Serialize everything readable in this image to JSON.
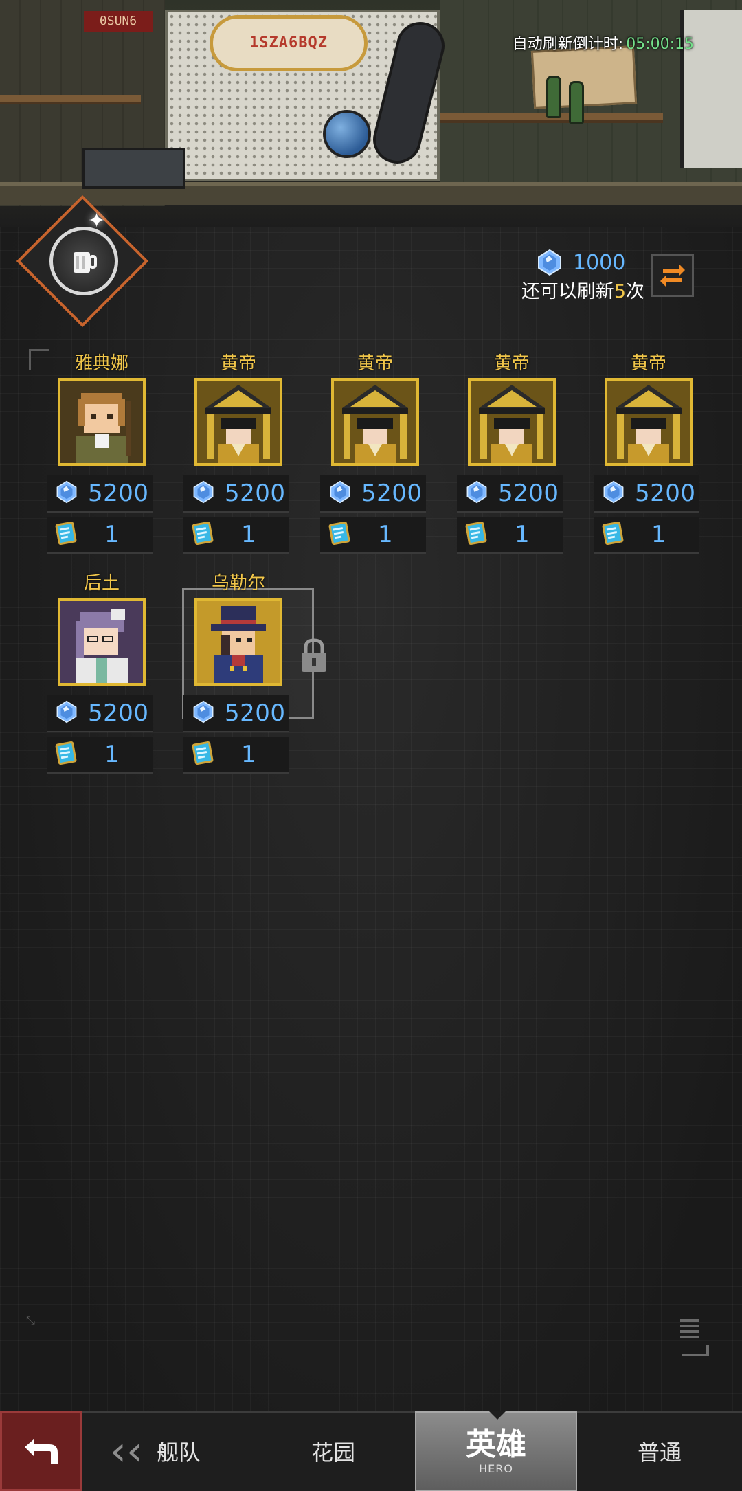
{
  "scene": {
    "sign_text": "1SZA6BQZ",
    "plate_text": "0SUN6",
    "refresh_timer_label": "自动刷新倒计时:",
    "refresh_timer_value": "05:00:15"
  },
  "currency": {
    "gem_icon": "blue-gem-icon",
    "amount": "1000",
    "refresh_prefix": "还可以刷新",
    "refresh_count": "5",
    "refresh_suffix": "次",
    "refresh_button_icon": "refresh-arrows-icon"
  },
  "heroes": [
    {
      "name": "雅典娜",
      "price": "5200",
      "tickets": "1",
      "portrait": "athena",
      "selected": false,
      "locked": false
    },
    {
      "name": "黄帝",
      "price": "5200",
      "tickets": "1",
      "portrait": "huangdi",
      "selected": false,
      "locked": false
    },
    {
      "name": "黄帝",
      "price": "5200",
      "tickets": "1",
      "portrait": "huangdi",
      "selected": false,
      "locked": false
    },
    {
      "name": "黄帝",
      "price": "5200",
      "tickets": "1",
      "portrait": "huangdi",
      "selected": false,
      "locked": false
    },
    {
      "name": "黄帝",
      "price": "5200",
      "tickets": "1",
      "portrait": "huangdi",
      "selected": false,
      "locked": false
    },
    {
      "name": "后土",
      "price": "5200",
      "tickets": "1",
      "portrait": "houtu",
      "selected": false,
      "locked": false
    },
    {
      "name": "乌勒尔",
      "price": "5200",
      "tickets": "1",
      "portrait": "ullr",
      "selected": true,
      "locked": true
    }
  ],
  "nav": {
    "back_icon": "return-arrow-icon",
    "tabs": [
      {
        "label": "舰队"
      },
      {
        "label": "花园"
      },
      {
        "label": "英雄",
        "sub": "HERO",
        "active": true
      },
      {
        "label": "普通"
      }
    ]
  },
  "colors": {
    "gold": "#f1c64a",
    "gem_blue": "#67b8ff",
    "timer_green": "#74e08a",
    "accent_orange": "#e08a2a"
  }
}
